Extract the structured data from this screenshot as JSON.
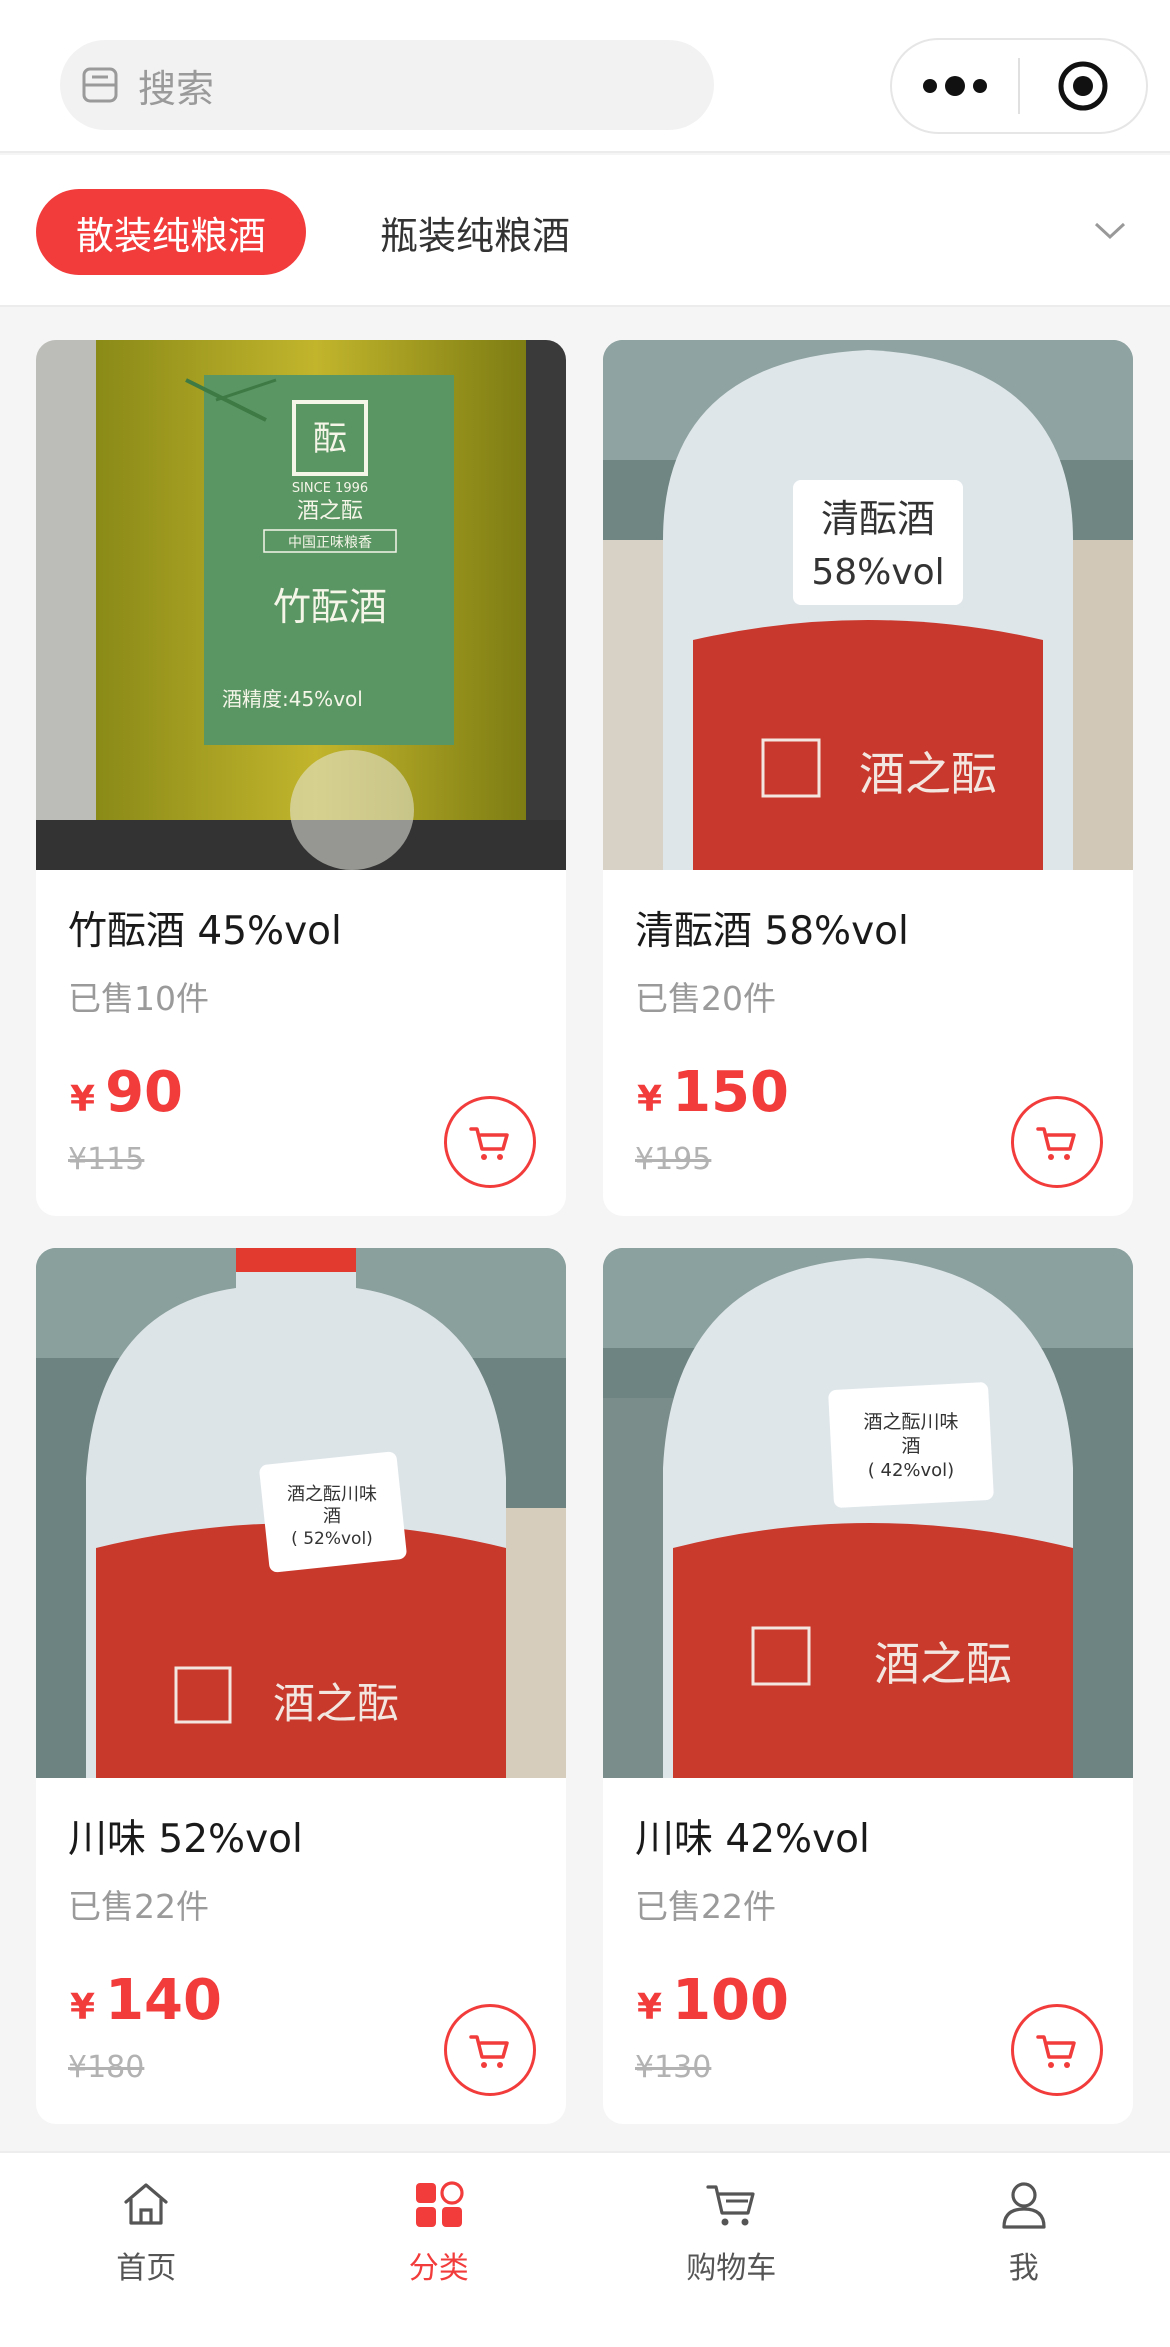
{
  "search": {
    "placeholder": "搜索"
  },
  "capsule": {
    "more_icon": "more-dots-icon",
    "home_icon": "target-icon"
  },
  "categories": {
    "active": "散装纯粮酒",
    "other": "瓶装纯粮酒",
    "expand_icon": "chevron-down-icon"
  },
  "products": [
    {
      "name": "竹酝酒 45%vol",
      "sold": "已售10件",
      "currency": "¥",
      "price": "90",
      "original": "¥115",
      "label_brand": "酒之酝",
      "label_sub": "中国正味粮香",
      "label_since": "SINCE 1996",
      "label_title": "竹酝酒",
      "label_abv": "酒精度:45%vol"
    },
    {
      "name": "清酝酒 58%vol",
      "sold": "已售20件",
      "currency": "¥",
      "price": "150",
      "original": "¥195",
      "label_line1": "清酝酒",
      "label_line2": "58%vol",
      "bottle_brand": "酒之酝"
    },
    {
      "name": "川味 52%vol",
      "sold": "已售22件",
      "currency": "¥",
      "price": "140",
      "original": "¥180",
      "label_line1": "酒之酝川味",
      "label_line2": "酒",
      "label_line3": "( 52%vol)",
      "bottle_brand": "酒之酝"
    },
    {
      "name": "川味 42%vol",
      "sold": "已售22件",
      "currency": "¥",
      "price": "100",
      "original": "¥130",
      "label_line1": "酒之酝川味",
      "label_line2": "酒",
      "label_line3": "( 42%vol)",
      "bottle_brand": "酒之酝"
    }
  ],
  "tabbar": [
    {
      "label": "首页",
      "icon": "home-icon",
      "active": false
    },
    {
      "label": "分类",
      "icon": "category-icon",
      "active": true
    },
    {
      "label": "购物车",
      "icon": "cart-icon",
      "active": false
    },
    {
      "label": "我",
      "icon": "user-icon",
      "active": false
    }
  ],
  "colors": {
    "accent": "#f23c3c",
    "background": "#f5f5f5"
  }
}
